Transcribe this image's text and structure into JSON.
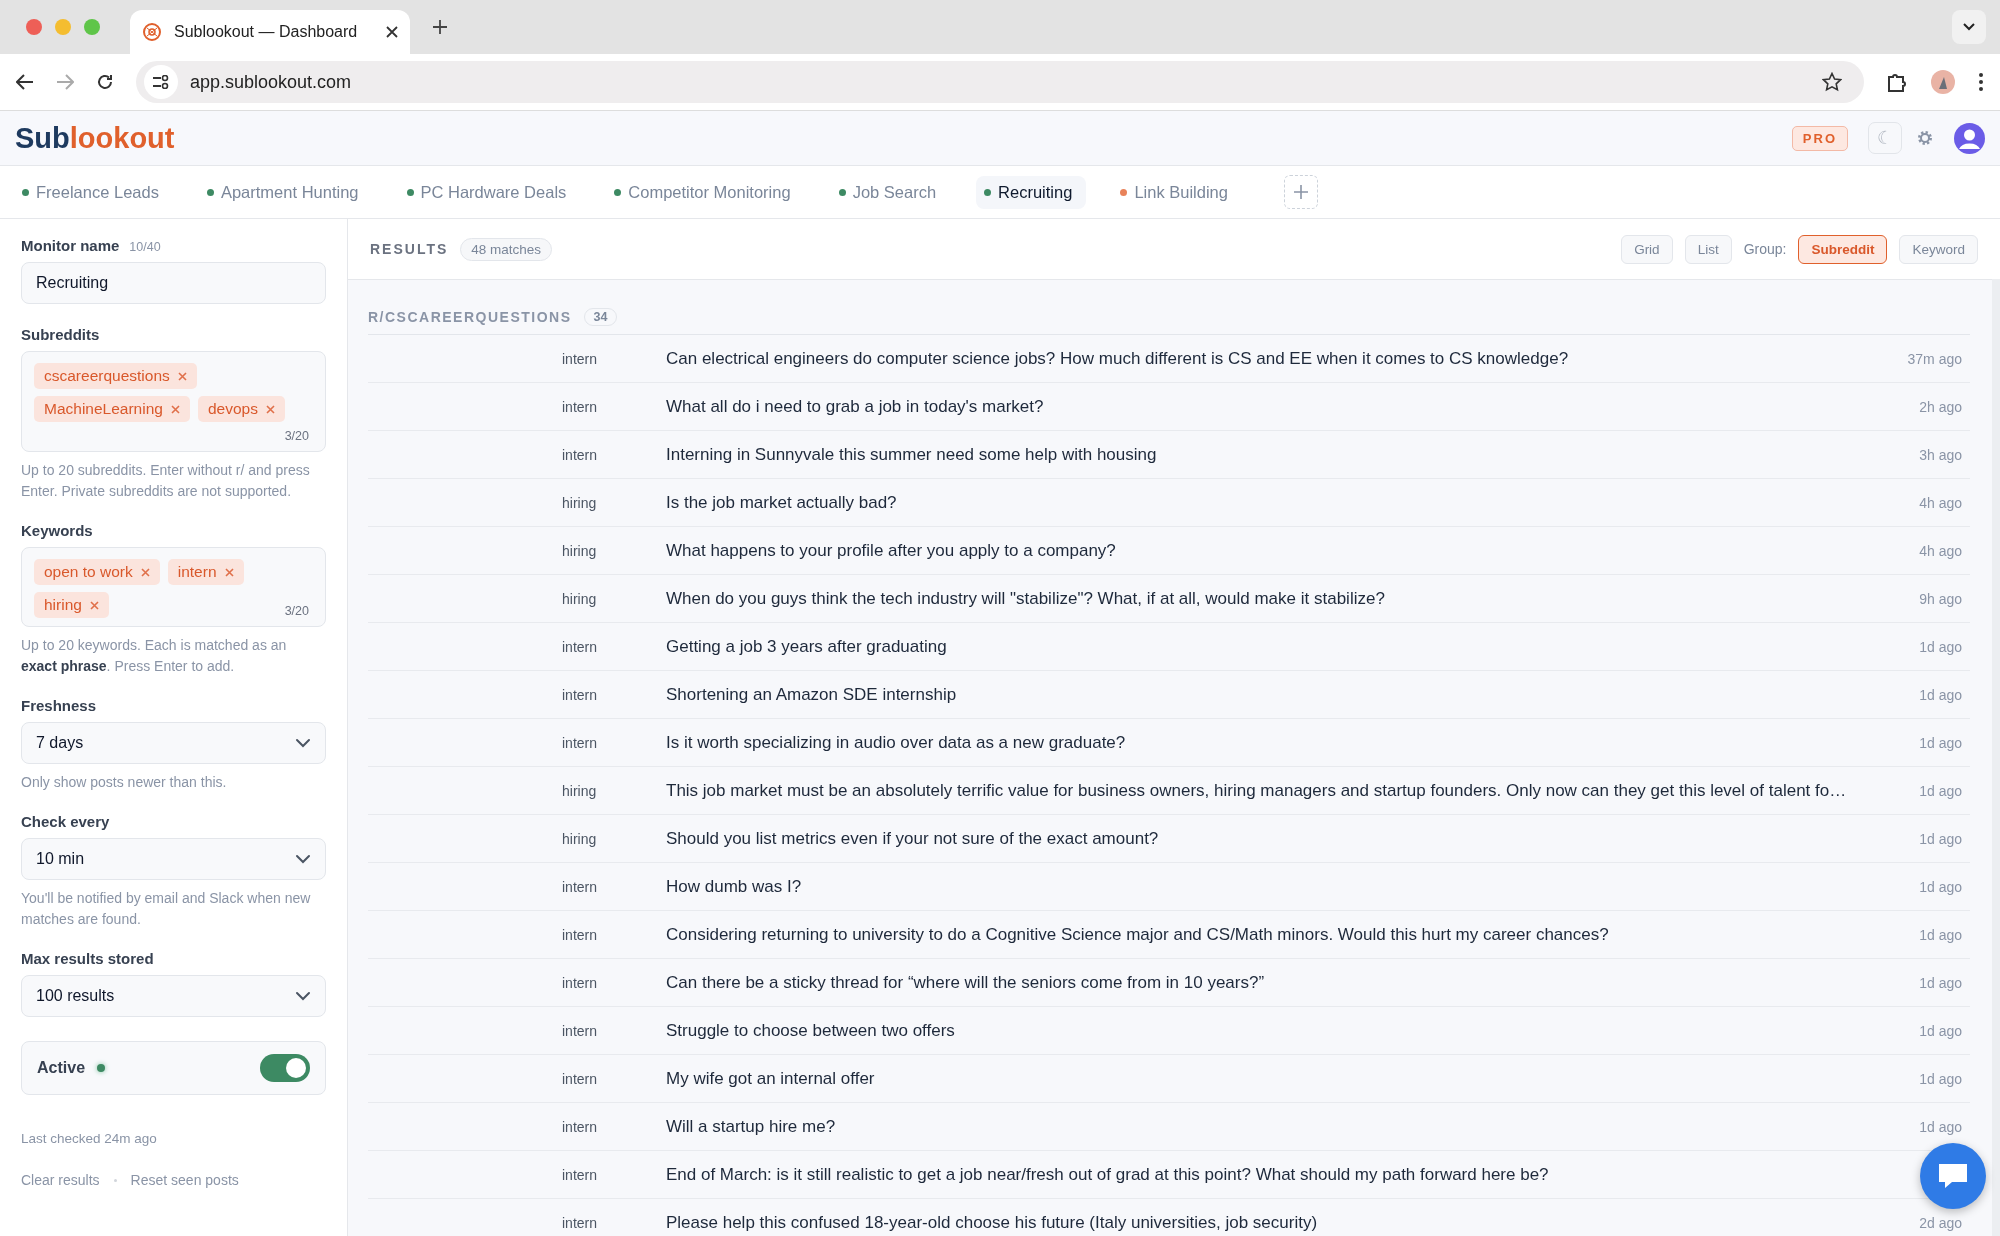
{
  "browser": {
    "tab_title": "Sublookout — Dashboard",
    "url": "app.sublookout.com"
  },
  "header": {
    "logo_first": "Sub",
    "logo_second": "lookout",
    "plan_badge": "PRO",
    "theme_toggle": "☾"
  },
  "monitor_tabs": [
    {
      "label": "Freelance Leads",
      "color": "#3d8a63",
      "selected": false
    },
    {
      "label": "Apartment Hunting",
      "color": "#3d8a63",
      "selected": false
    },
    {
      "label": "PC Hardware Deals",
      "color": "#3d8a63",
      "selected": false
    },
    {
      "label": "Competitor Monitoring",
      "color": "#3d8a63",
      "selected": false
    },
    {
      "label": "Job Search",
      "color": "#3d8a63",
      "selected": false
    },
    {
      "label": "Recruiting",
      "color": "#3d8a63",
      "selected": true
    },
    {
      "label": "Link Building",
      "color": "#e8825a",
      "selected": false
    }
  ],
  "sidebar": {
    "monitor_name": {
      "label": "Monitor name",
      "count": "10/40",
      "value": "Recruiting"
    },
    "subreddits": {
      "label": "Subreddits",
      "tags": [
        "cscareerquestions",
        "MachineLearning",
        "devops"
      ],
      "count": "3/20",
      "help": "Up to 20 subreddits. Enter without r/ and press Enter. Private subreddits are not supported."
    },
    "keywords": {
      "label": "Keywords",
      "tags": [
        "open to work",
        "intern",
        "hiring"
      ],
      "count": "3/20",
      "help": "Up to 20 keywords. Each is matched as an **exact phrase**. Press Enter to add."
    },
    "selects": [
      {
        "label": "Freshness",
        "value": "7 days",
        "help": "Only show posts newer than this."
      },
      {
        "label": "Check every",
        "value": "10 min",
        "help": "You'll be notified by email and Slack when new matches are found."
      },
      {
        "label": "Max results stored",
        "value": "100 results"
      }
    ],
    "active": {
      "label": "Active",
      "on": true
    },
    "last_checked": "Last checked 24m ago",
    "links": [
      "Clear results",
      "Reset seen posts"
    ]
  },
  "results": {
    "title": "RESULTS",
    "count": "48 matches",
    "view_buttons": [
      {
        "label": "Grid",
        "selected": false
      },
      {
        "label": "List",
        "selected": false
      }
    ],
    "group_label": "Group:",
    "group_buttons": [
      {
        "label": "Subreddit",
        "selected": true
      },
      {
        "label": "Keyword",
        "selected": false
      }
    ],
    "group": {
      "name": "R/CSCAREERQUESTIONS",
      "count": "34",
      "rows": [
        {
          "keyword": "intern",
          "title": "Can electrical engineers do computer science jobs? How much different is CS and EE when it comes to CS knowledge?",
          "time": "37m ago"
        },
        {
          "keyword": "intern",
          "title": "What all do i need to grab a job in today's market?",
          "time": "2h ago"
        },
        {
          "keyword": "intern",
          "title": "Interning in Sunnyvale this summer need some help with housing",
          "time": "3h ago"
        },
        {
          "keyword": "hiring",
          "title": "Is the job market actually bad?",
          "time": "4h ago"
        },
        {
          "keyword": "hiring",
          "title": "What happens to your profile after you apply to a company?",
          "time": "4h ago"
        },
        {
          "keyword": "hiring",
          "title": "When do you guys think the tech industry will \"stabilize\"? What, if at all, would make it stabilize?",
          "time": "9h ago"
        },
        {
          "keyword": "intern",
          "title": "Getting a job 3 years after graduating",
          "time": "1d ago"
        },
        {
          "keyword": "intern",
          "title": "Shortening an Amazon SDE internship",
          "time": "1d ago"
        },
        {
          "keyword": "intern",
          "title": "Is it worth specializing in audio over data as a new graduate?",
          "time": "1d ago"
        },
        {
          "keyword": "hiring",
          "title": "This job market must be an absolutely terrific value for business owners, hiring managers and startup founders. Only now can they get this level of talent fo…",
          "time": "1d ago"
        },
        {
          "keyword": "hiring",
          "title": "Should you list metrics even if your not sure of the exact amount?",
          "time": "1d ago"
        },
        {
          "keyword": "intern",
          "title": "How dumb was I?",
          "time": "1d ago"
        },
        {
          "keyword": "intern",
          "title": "Considering returning to university to do a Cognitive Science major and CS/Math minors. Would this hurt my career chances?",
          "time": "1d ago"
        },
        {
          "keyword": "intern",
          "title": "Can there be a sticky thread for “where will the seniors come from in 10 years?”",
          "time": "1d ago"
        },
        {
          "keyword": "intern",
          "title": "Struggle to choose between two offers",
          "time": "1d ago"
        },
        {
          "keyword": "intern",
          "title": "My wife got an internal offer",
          "time": "1d ago"
        },
        {
          "keyword": "intern",
          "title": "Will a startup hire me?",
          "time": "1d ago"
        },
        {
          "keyword": "intern",
          "title": "End of March: is it still realistic to get a job near/fresh out of grad at this point? What should my path forward here be?"
        },
        {
          "keyword": "intern",
          "title": "Please help this confused 18-year-old choose his future (Italy universities, job security)",
          "time": "2d ago"
        }
      ]
    }
  }
}
